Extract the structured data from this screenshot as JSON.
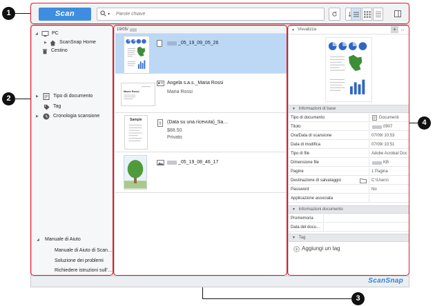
{
  "callouts": [
    "1",
    "2",
    "3",
    "4"
  ],
  "toolbar": {
    "scan_label": "Scan",
    "search_placeholder": "Parole chiave",
    "search_icon": "search-icon",
    "refresh_icon": "refresh-icon",
    "sort_icon": "sort-icon",
    "views": [
      "list-view-icon",
      "grid-view-icon",
      "detail-view-icon",
      "panel-toggle-icon"
    ]
  },
  "nav": {
    "pc_label": "PC",
    "scansnap_home_label": "ScanSnap Home",
    "trash_label": "Cestino",
    "doc_type_label": "Tipo di documento",
    "tag_label": "Tag",
    "history_label": "Cronologia scansione",
    "help_header": "Manuale di Aiuto",
    "help_items": [
      "Manuale di Aiuto di Scan…",
      "Soluzione dei problemi",
      "Richiedere istruzioni sull'…"
    ]
  },
  "list": {
    "date_header": "19/05/",
    "items": [
      {
        "title": "_05_19_09_05_26",
        "sub1": "",
        "sub2": ""
      },
      {
        "title": "Angela s.a.s._Maria Rossi",
        "sub1": "Maria Rossi",
        "sub2": ""
      },
      {
        "title": "(Data su una ricevuta)_Sa…",
        "sub1": "$88.50",
        "sub2": "Privato"
      },
      {
        "title": "_05_19_08_46_17",
        "sub1": "",
        "sub2": ""
      }
    ],
    "thumb_texts": {
      "receipt_title": "Sample",
      "card_name": "Mario Rossi"
    }
  },
  "detail": {
    "header": "Visualizza",
    "basic_header": "Informazioni di base",
    "basic_rows": [
      {
        "k": "Tipo di documento",
        "v": "Documenti"
      },
      {
        "k": "Titolo",
        "v": "0907"
      },
      {
        "k": "Ora/Data di scansione",
        "v": "07/09/  10:53"
      },
      {
        "k": "Data di modifica",
        "v": "07/09/  10:51"
      },
      {
        "k": "Tipo di file",
        "v": "Adobe Acrobat Doc"
      },
      {
        "k": "Dimensione file",
        "v": "KB"
      },
      {
        "k": "Pagine",
        "v": "1 Pagina"
      },
      {
        "k": "Destinazione di salvataggio",
        "v": "C:\\Users\\"
      },
      {
        "k": "Password",
        "v": "No"
      },
      {
        "k": "Applicazione associata",
        "v": ""
      }
    ],
    "doc_header": "Informazioni documento",
    "doc_rows": [
      {
        "k": "Promemoria",
        "v": ""
      },
      {
        "k": "Data del docu…",
        "v": ""
      }
    ],
    "tag_header": "Tag",
    "add_tag_label": "Aggiungi un tag"
  },
  "footer": {
    "brand": "ScanSnap"
  },
  "colors": {
    "accent": "#3f8de0",
    "selection": "#bcd8f5",
    "callout": "#111111",
    "brand": "#2f82d8"
  }
}
